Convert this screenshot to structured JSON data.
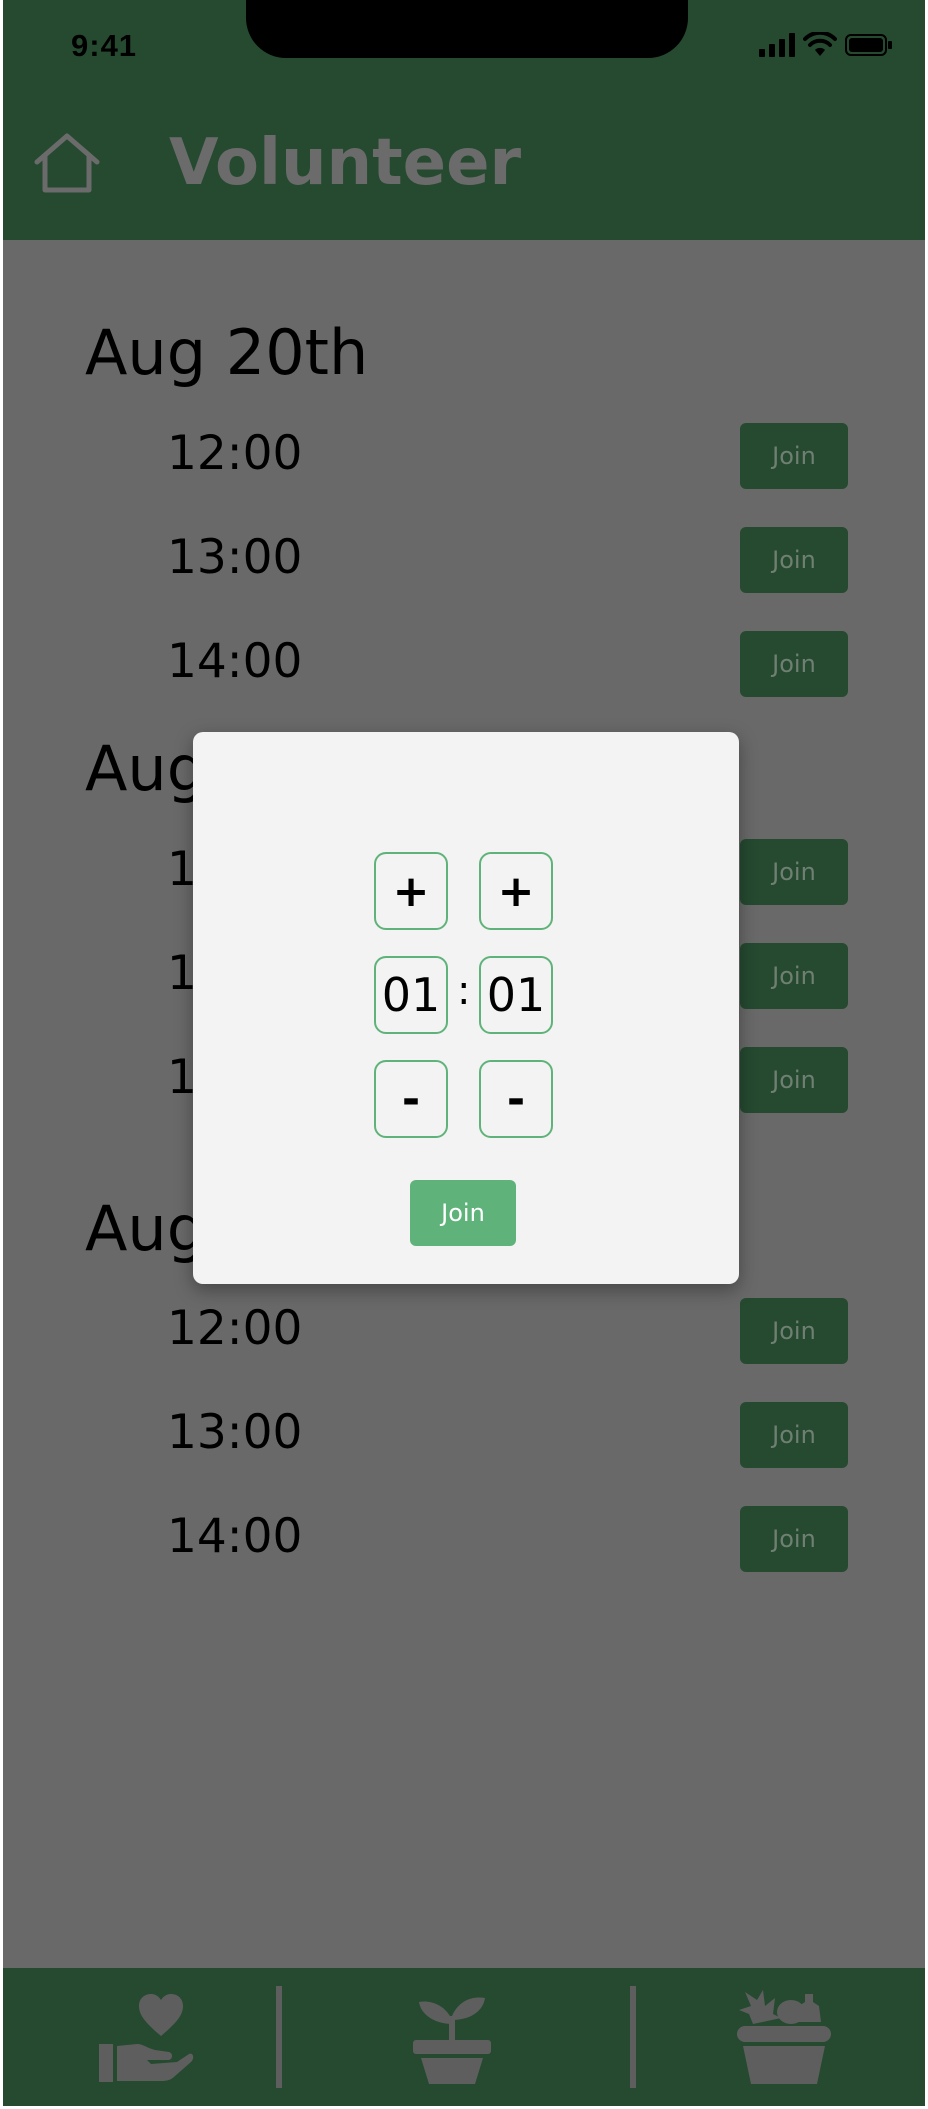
{
  "status_bar": {
    "time": "9:41"
  },
  "header": {
    "title": "Volunteer",
    "home_icon": "home-icon"
  },
  "schedule": [
    {
      "date": "Aug 20th",
      "slots": [
        {
          "time": "12:00",
          "action": "Join"
        },
        {
          "time": "13:00",
          "action": "Join"
        },
        {
          "time": "14:00",
          "action": "Join"
        }
      ]
    },
    {
      "date": "Aug",
      "slots": [
        {
          "time": "1",
          "action": "Join"
        },
        {
          "time": "1",
          "action": "Join"
        },
        {
          "time": "1",
          "action": "Join"
        }
      ]
    },
    {
      "date": "Aug",
      "slots": [
        {
          "time": "12:00",
          "action": "Join"
        },
        {
          "time": "13:00",
          "action": "Join"
        },
        {
          "time": "14:00",
          "action": "Join"
        }
      ]
    }
  ],
  "modal": {
    "hour_increment": "+",
    "minute_increment": "+",
    "hour_value": "01",
    "separator": ":",
    "minute_value": "01",
    "hour_decrement": "-",
    "minute_decrement": "-",
    "join_label": "Join"
  },
  "bottom_nav": {
    "items": [
      {
        "icon": "donate-hand-heart-icon"
      },
      {
        "icon": "potted-plant-icon"
      },
      {
        "icon": "vegetable-basket-icon"
      }
    ]
  },
  "colors": {
    "header_green": "#254a30",
    "overlay_gray": "#696969",
    "accent_green": "#5fb37a",
    "modal_bg": "#f3f3f3"
  }
}
